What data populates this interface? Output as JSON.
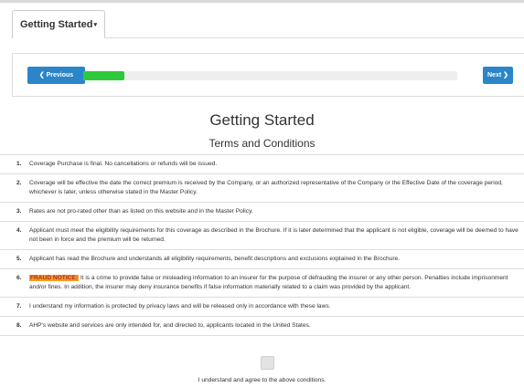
{
  "tab": {
    "label": "Getting Started",
    "caret": "▾"
  },
  "nav": {
    "previous_label": "❮ Previous",
    "next_label": "Next ❯",
    "progress": 0.11
  },
  "page": {
    "title": "Getting Started",
    "subtitle": "Terms and Conditions"
  },
  "terms": [
    {
      "num": "1.",
      "text": "Coverage Purchase is final. No cancellations or refunds will be issued."
    },
    {
      "num": "2.",
      "text": "Coverage will be effective the date the correct premium is received by the Company, or an authorized representative of the Company or the Effective Date of the coverage period, whichever is later, unless otherwise stated in the Master Policy."
    },
    {
      "num": "3.",
      "text": "Rates are not pro-rated other than as listed on this website and in the Master Policy."
    },
    {
      "num": "4.",
      "text": "Applicant must meet the eligibility requirements for this coverage as described in the Brochure. If it is later determined that the applicant is not eligible, coverage will be deemed to have not been in force and the premium will be returned."
    },
    {
      "num": "5.",
      "text": "Applicant has read the Brochure and understands all eligibility requirements, benefit descriptions and exclusions explained in the Brochure."
    },
    {
      "num": "6.",
      "highlight": "FRAUD NOTICE:",
      "text": " It is a crime to provide false or misleading information to an insurer for the purpose of defrauding the insurer or any other person. Penalties include imprisonment and/or fines. In addition, the insurer may deny insurance benefits if false information materially related to a claim was provided by the applicant."
    },
    {
      "num": "7.",
      "text": "I understand my information is protected by privacy laws and will be released only in accordance with these laws."
    },
    {
      "num": "8.",
      "text": "AHP's website and services are only intended for, and directed to, applicants located in the United States."
    }
  ],
  "agree": {
    "label": "I understand and agree to the above conditions.",
    "checked": false
  },
  "colors": {
    "primary_button": "#2a86c8",
    "progress_fill": "#2ec93a",
    "fraud_highlight_bg": "#f0a023",
    "fraud_highlight_text": "#b4272b"
  }
}
